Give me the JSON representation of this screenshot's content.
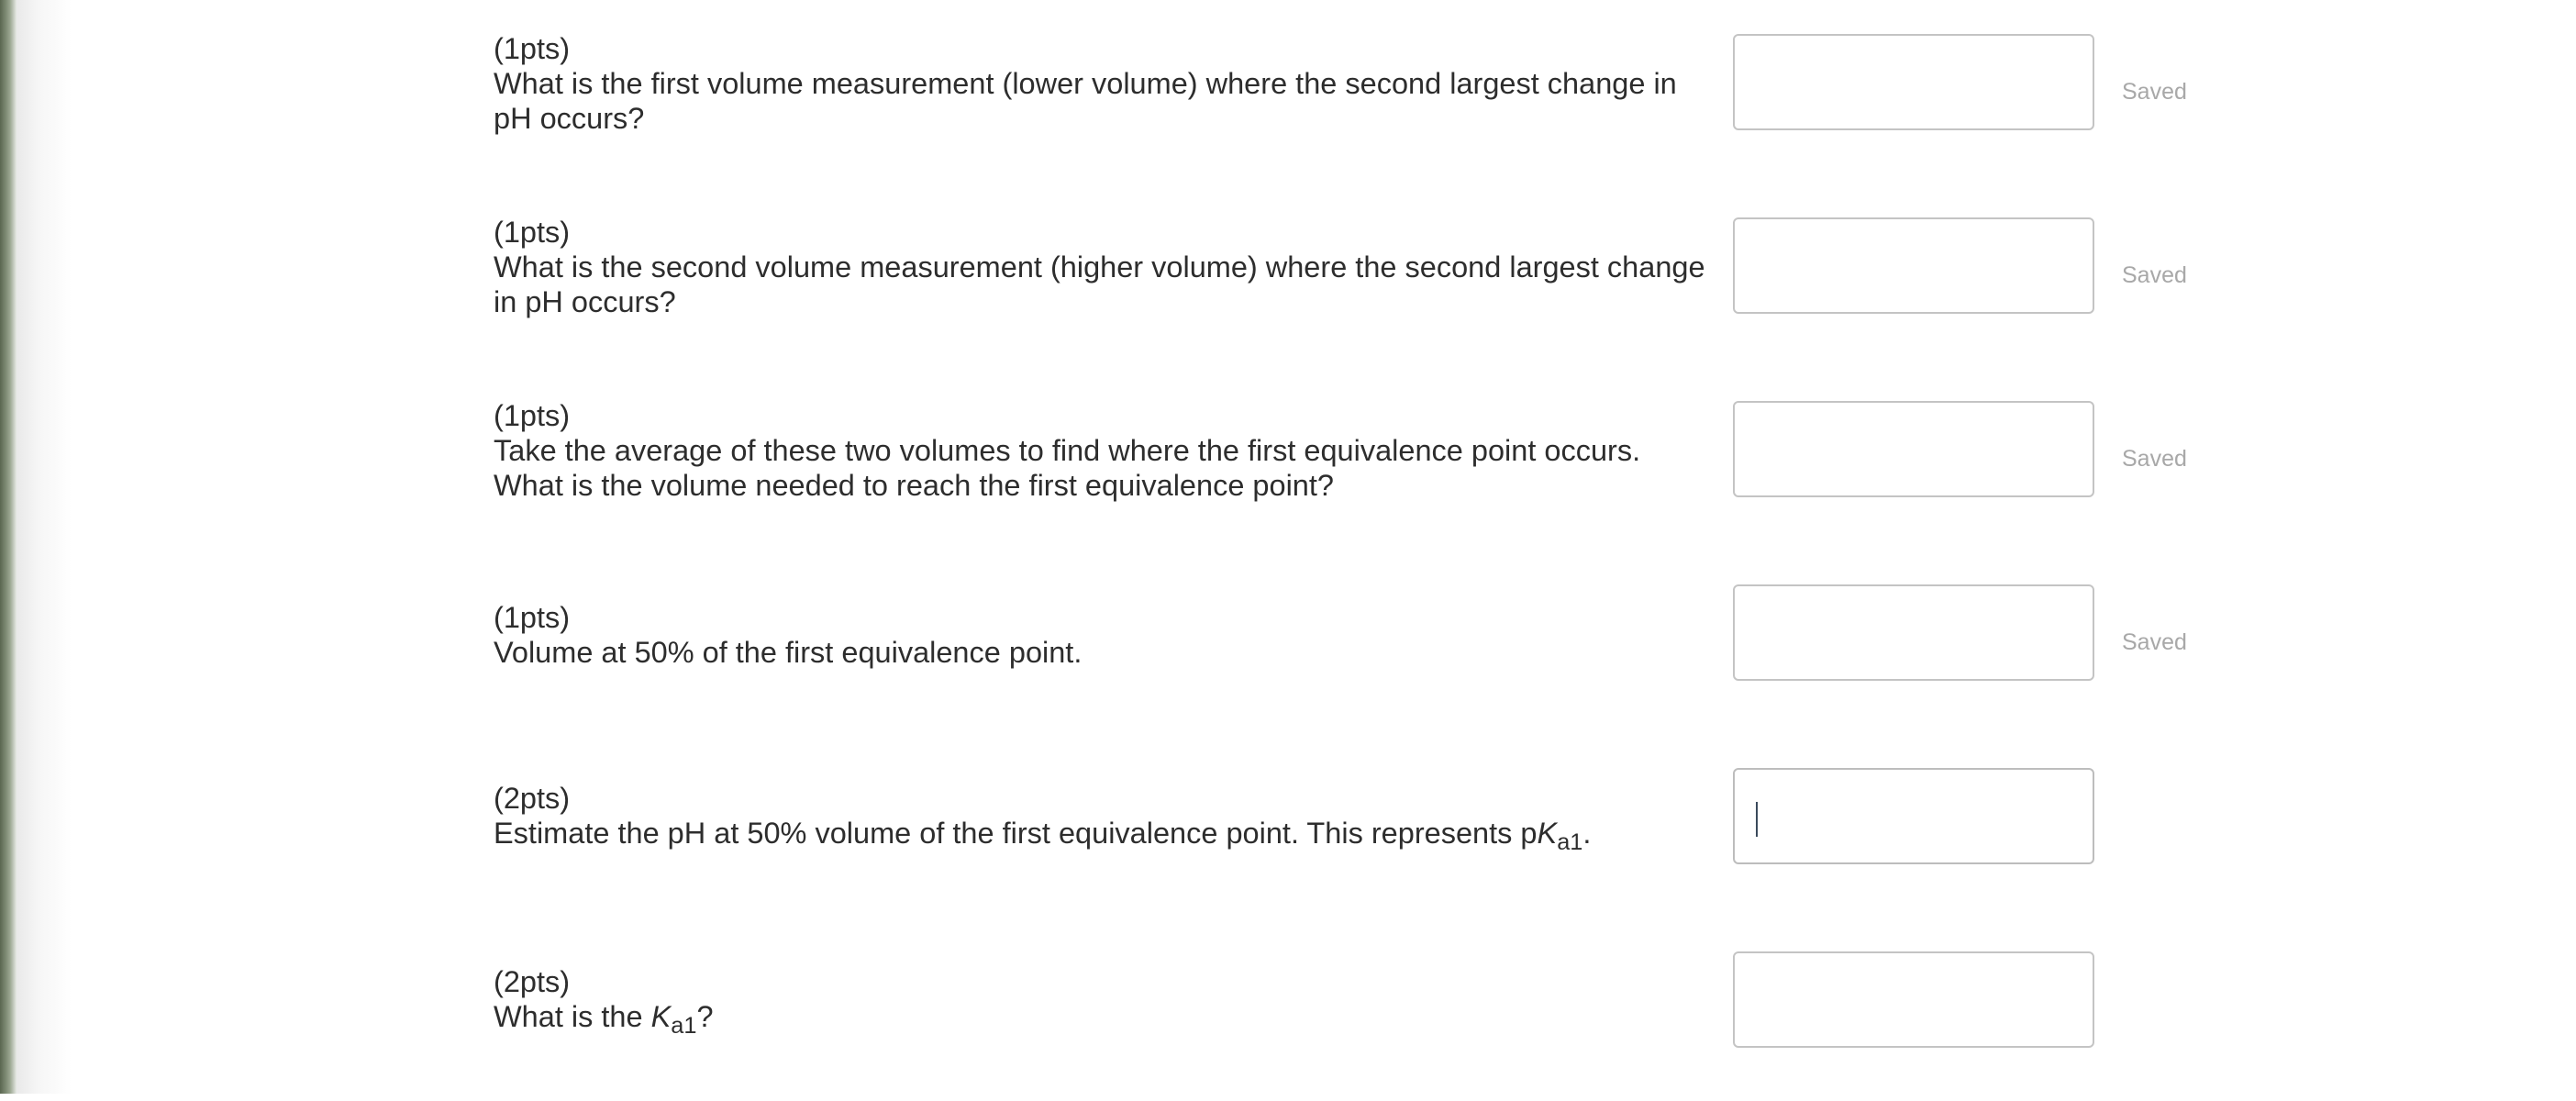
{
  "questions": [
    {
      "points": "(1pts)",
      "text": "What is the first volume measurement (lower volume) where the second largest change in pH occurs?",
      "answer": "",
      "status": "Saved"
    },
    {
      "points": "(1pts)",
      "text": "What is the second volume measurement (higher volume) where the second largest change in pH occurs?",
      "answer": "",
      "status": "Saved"
    },
    {
      "points": "(1pts)",
      "text": "Take the average of these two volumes to find where the first equivalence point occurs. What is the volume needed to reach the first equivalence point?",
      "answer": "",
      "status": "Saved"
    },
    {
      "points": "(1pts)",
      "text": "Volume at 50% of the first equivalence point.",
      "answer": "",
      "status": "Saved"
    },
    {
      "points": "(2pts)",
      "text_before": "Estimate the pH at 50% volume of the first equivalence point. This represents p",
      "symbol": "K",
      "subscript": "a1",
      "text_after": ".",
      "answer": "",
      "status": ""
    },
    {
      "points": "(2pts)",
      "text_before": "What is the ",
      "symbol": "K",
      "subscript": "a1",
      "text_after": "?",
      "answer": "",
      "status": ""
    }
  ]
}
